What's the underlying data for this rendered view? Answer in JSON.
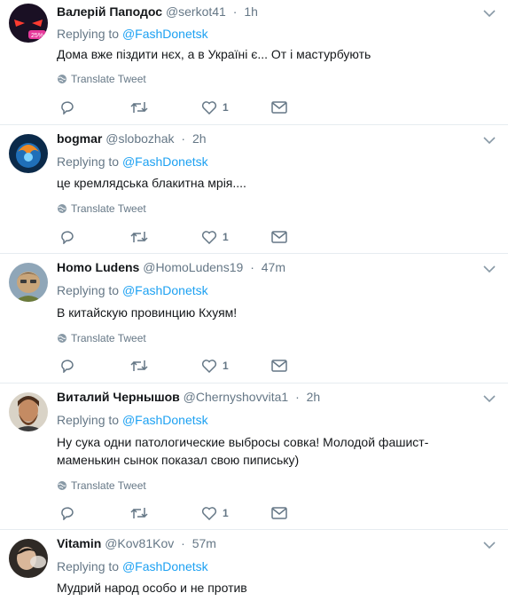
{
  "ui": {
    "replying_prefix": "Replying to",
    "translate_label": "Translate Tweet"
  },
  "tweets": [
    {
      "name": "Валерій Паподос",
      "handle": "@serkot41",
      "time": "1h",
      "replying_to": "@FashDonetsk",
      "text": "Дома вже піздити нєх, а в Україні є... От і мастурбують",
      "likes": "1",
      "avatar_badge": "25%"
    },
    {
      "name": "bogmar",
      "handle": "@slobozhak",
      "time": "2h",
      "replying_to": "@FashDonetsk",
      "text": "це кремлядська блакитна мрія....",
      "likes": "1"
    },
    {
      "name": "Homo Ludens",
      "handle": "@HomoLudens19",
      "time": "47m",
      "replying_to": "@FashDonetsk",
      "text": "В китайскую провинцию Кхуям!",
      "likes": "1"
    },
    {
      "name": "Виталий Чернышов",
      "handle": "@Chernyshovvita1",
      "time": "2h",
      "replying_to": "@FashDonetsk",
      "text_lines": [
        "Ну сука одни патологические выбросы совка! Молодой фашист-",
        "маменькин сынок показал свою пипиську)"
      ],
      "likes": "1"
    },
    {
      "name": "Vitamin",
      "handle": "@Kov81Kov",
      "time": "57m",
      "replying_to": "@FashDonetsk",
      "text": "Мудрий народ особо и не против"
    }
  ]
}
